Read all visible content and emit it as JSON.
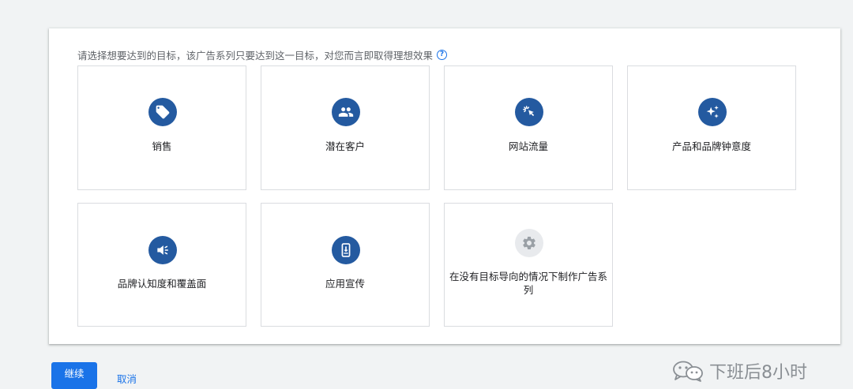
{
  "prompt": {
    "text": "请选择想要达到的目标，该广告系列只要达到这一目标，对您而言即取得理想效果",
    "help_glyph": "?"
  },
  "goals": [
    {
      "label": "销售",
      "icon": "tag-icon"
    },
    {
      "label": "潜在客户",
      "icon": "people-icon"
    },
    {
      "label": "网站流量",
      "icon": "cursor-click-icon"
    },
    {
      "label": "产品和品牌钟意度",
      "icon": "sparkle-icon"
    },
    {
      "label": "品牌认知度和覆盖面",
      "icon": "megaphone-icon"
    },
    {
      "label": "应用宣传",
      "icon": "phone-download-icon"
    },
    {
      "label": "在没有目标导向的情况下制作广告系列",
      "icon": "gear-icon"
    }
  ],
  "actions": {
    "continue_label": "继续",
    "cancel_label": "取消"
  },
  "watermark": {
    "text": "下班后8小时",
    "icon": "wechat-icon"
  },
  "colors": {
    "accent": "#1a73e8",
    "icon_circle": "#245aa0",
    "icon_circle_disabled": "#e8eaed"
  }
}
